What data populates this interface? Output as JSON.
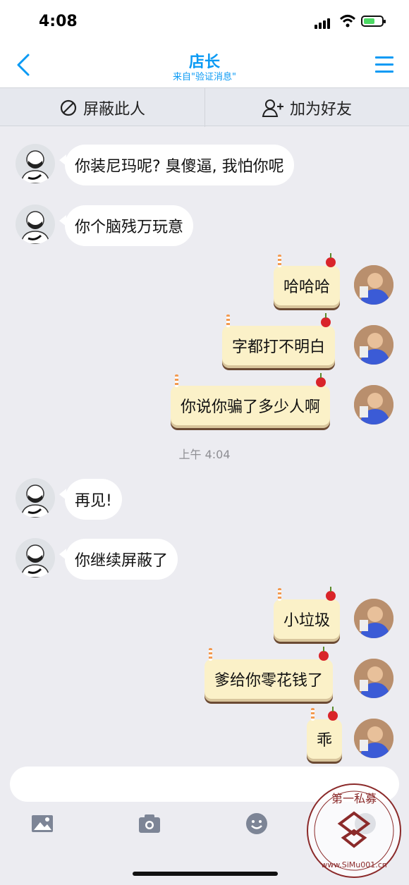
{
  "status": {
    "time": "4:08"
  },
  "nav": {
    "title": "店长",
    "subtitle": "来自\"验证消息\""
  },
  "actions": {
    "block_label": "屏蔽此人",
    "add_friend_label": "加为好友"
  },
  "messages": [
    {
      "side": "left",
      "text": "你装尼玛呢? 臭傻逼, 我怕你呢"
    },
    {
      "side": "left",
      "text": "你个脑残万玩意"
    },
    {
      "side": "right",
      "text": "哈哈哈"
    },
    {
      "side": "right",
      "text": "字都打不明白"
    },
    {
      "side": "right",
      "text": "你说你骗了多少人啊"
    },
    {
      "side": "left",
      "text": "再见!"
    },
    {
      "side": "left",
      "text": "你继续屏蔽了"
    },
    {
      "side": "right",
      "text": "小垃圾"
    },
    {
      "side": "right",
      "text": "爹给你零花钱了"
    },
    {
      "side": "right",
      "text": "乖"
    }
  ],
  "time_separator": "上午 4:04",
  "watermark": {
    "text": "第一私募",
    "url": "www.SiMu001.cn"
  },
  "colors": {
    "accent": "#0a9af4",
    "bubble_right": "#fbf1c8",
    "bg": "#ececf1"
  }
}
